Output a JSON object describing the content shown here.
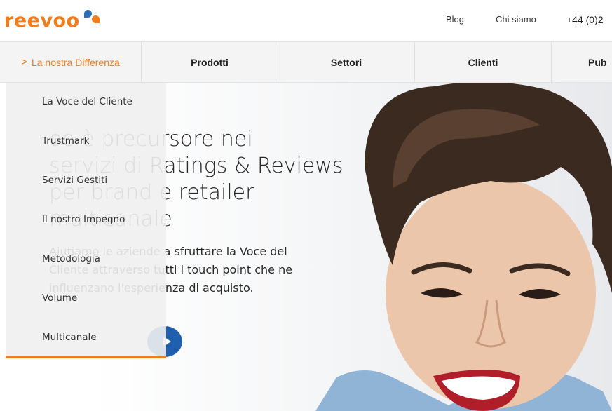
{
  "brand": {
    "name": "reevoo",
    "orange": "#f07c1c",
    "blue": "#2f6fb5"
  },
  "toplinks": {
    "blog": "Blog",
    "about": "Chi siamo",
    "phone": "+44 (0)2"
  },
  "nav": {
    "active": {
      "chevron": ">",
      "label": "La nostra Differenza"
    },
    "items": [
      "Prodotti",
      "Settori",
      "Clienti",
      "Pub"
    ]
  },
  "dropdown": {
    "items": [
      "La Voce del Cliente",
      "Trustmark",
      "Servizi Gestiti",
      "Il nostro Impegno",
      "Metodologia",
      "Volume",
      "Multicanale"
    ]
  },
  "hero": {
    "title_lines": [
      "oo è precursore nei",
      "servizi di Ratings & Reviews",
      "per brand e retailer",
      "multicanale"
    ],
    "text_lines": [
      "Aiutiamo le aziende a sfruttare la Voce del",
      "Cliente attraverso tutti i touch point che ne",
      "influenzano l'esperienza di acquisto."
    ],
    "play_icon": "play-icon",
    "play_color": "#1f5fae"
  }
}
